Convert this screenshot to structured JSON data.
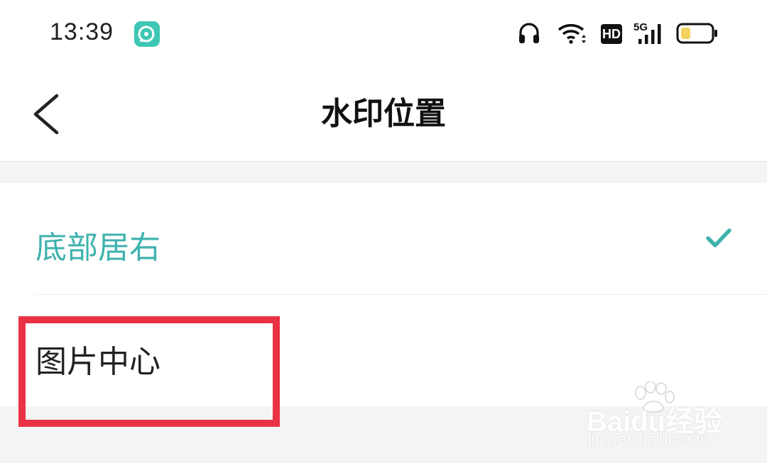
{
  "status_bar": {
    "time": "13:39",
    "network": "5G",
    "hd": "HD",
    "icons": [
      "app-badge-icon",
      "headphones-icon",
      "wifi-icon",
      "hd-icon",
      "signal-icon",
      "battery-icon"
    ]
  },
  "nav": {
    "title": "水印位置",
    "back_icon": "chevron-left-icon"
  },
  "options": [
    {
      "label": "底部居右",
      "selected": true
    },
    {
      "label": "图片中心",
      "selected": false
    }
  ],
  "watermark": {
    "brand": "Baidu经验",
    "url": "jingyan.baidu.com"
  },
  "colors": {
    "accent": "#3fb2ad",
    "highlight": "#ea3245",
    "app_badge": "#3ec7b4"
  }
}
